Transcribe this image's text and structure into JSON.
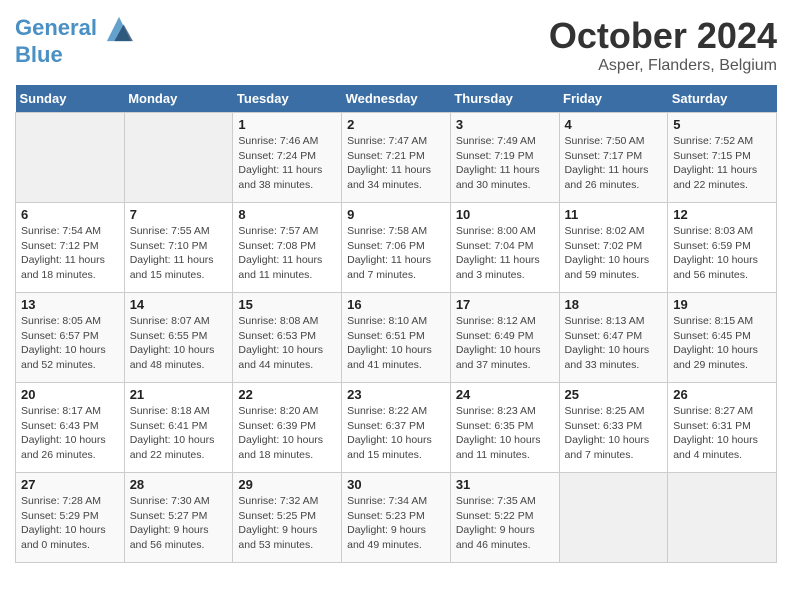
{
  "header": {
    "logo_line1": "General",
    "logo_line2": "Blue",
    "month": "October 2024",
    "location": "Asper, Flanders, Belgium"
  },
  "days_of_week": [
    "Sunday",
    "Monday",
    "Tuesday",
    "Wednesday",
    "Thursday",
    "Friday",
    "Saturday"
  ],
  "weeks": [
    [
      {
        "day": "",
        "info": ""
      },
      {
        "day": "",
        "info": ""
      },
      {
        "day": "1",
        "sunrise": "7:46 AM",
        "sunset": "7:24 PM",
        "daylight": "11 hours and 38 minutes."
      },
      {
        "day": "2",
        "sunrise": "7:47 AM",
        "sunset": "7:21 PM",
        "daylight": "11 hours and 34 minutes."
      },
      {
        "day": "3",
        "sunrise": "7:49 AM",
        "sunset": "7:19 PM",
        "daylight": "11 hours and 30 minutes."
      },
      {
        "day": "4",
        "sunrise": "7:50 AM",
        "sunset": "7:17 PM",
        "daylight": "11 hours and 26 minutes."
      },
      {
        "day": "5",
        "sunrise": "7:52 AM",
        "sunset": "7:15 PM",
        "daylight": "11 hours and 22 minutes."
      }
    ],
    [
      {
        "day": "6",
        "sunrise": "7:54 AM",
        "sunset": "7:12 PM",
        "daylight": "11 hours and 18 minutes."
      },
      {
        "day": "7",
        "sunrise": "7:55 AM",
        "sunset": "7:10 PM",
        "daylight": "11 hours and 15 minutes."
      },
      {
        "day": "8",
        "sunrise": "7:57 AM",
        "sunset": "7:08 PM",
        "daylight": "11 hours and 11 minutes."
      },
      {
        "day": "9",
        "sunrise": "7:58 AM",
        "sunset": "7:06 PM",
        "daylight": "11 hours and 7 minutes."
      },
      {
        "day": "10",
        "sunrise": "8:00 AM",
        "sunset": "7:04 PM",
        "daylight": "11 hours and 3 minutes."
      },
      {
        "day": "11",
        "sunrise": "8:02 AM",
        "sunset": "7:02 PM",
        "daylight": "10 hours and 59 minutes."
      },
      {
        "day": "12",
        "sunrise": "8:03 AM",
        "sunset": "6:59 PM",
        "daylight": "10 hours and 56 minutes."
      }
    ],
    [
      {
        "day": "13",
        "sunrise": "8:05 AM",
        "sunset": "6:57 PM",
        "daylight": "10 hours and 52 minutes."
      },
      {
        "day": "14",
        "sunrise": "8:07 AM",
        "sunset": "6:55 PM",
        "daylight": "10 hours and 48 minutes."
      },
      {
        "day": "15",
        "sunrise": "8:08 AM",
        "sunset": "6:53 PM",
        "daylight": "10 hours and 44 minutes."
      },
      {
        "day": "16",
        "sunrise": "8:10 AM",
        "sunset": "6:51 PM",
        "daylight": "10 hours and 41 minutes."
      },
      {
        "day": "17",
        "sunrise": "8:12 AM",
        "sunset": "6:49 PM",
        "daylight": "10 hours and 37 minutes."
      },
      {
        "day": "18",
        "sunrise": "8:13 AM",
        "sunset": "6:47 PM",
        "daylight": "10 hours and 33 minutes."
      },
      {
        "day": "19",
        "sunrise": "8:15 AM",
        "sunset": "6:45 PM",
        "daylight": "10 hours and 29 minutes."
      }
    ],
    [
      {
        "day": "20",
        "sunrise": "8:17 AM",
        "sunset": "6:43 PM",
        "daylight": "10 hours and 26 minutes."
      },
      {
        "day": "21",
        "sunrise": "8:18 AM",
        "sunset": "6:41 PM",
        "daylight": "10 hours and 22 minutes."
      },
      {
        "day": "22",
        "sunrise": "8:20 AM",
        "sunset": "6:39 PM",
        "daylight": "10 hours and 18 minutes."
      },
      {
        "day": "23",
        "sunrise": "8:22 AM",
        "sunset": "6:37 PM",
        "daylight": "10 hours and 15 minutes."
      },
      {
        "day": "24",
        "sunrise": "8:23 AM",
        "sunset": "6:35 PM",
        "daylight": "10 hours and 11 minutes."
      },
      {
        "day": "25",
        "sunrise": "8:25 AM",
        "sunset": "6:33 PM",
        "daylight": "10 hours and 7 minutes."
      },
      {
        "day": "26",
        "sunrise": "8:27 AM",
        "sunset": "6:31 PM",
        "daylight": "10 hours and 4 minutes."
      }
    ],
    [
      {
        "day": "27",
        "sunrise": "7:28 AM",
        "sunset": "5:29 PM",
        "daylight": "10 hours and 0 minutes."
      },
      {
        "day": "28",
        "sunrise": "7:30 AM",
        "sunset": "5:27 PM",
        "daylight": "9 hours and 56 minutes."
      },
      {
        "day": "29",
        "sunrise": "7:32 AM",
        "sunset": "5:25 PM",
        "daylight": "9 hours and 53 minutes."
      },
      {
        "day": "30",
        "sunrise": "7:34 AM",
        "sunset": "5:23 PM",
        "daylight": "9 hours and 49 minutes."
      },
      {
        "day": "31",
        "sunrise": "7:35 AM",
        "sunset": "5:22 PM",
        "daylight": "9 hours and 46 minutes."
      },
      {
        "day": "",
        "info": ""
      },
      {
        "day": "",
        "info": ""
      }
    ]
  ]
}
